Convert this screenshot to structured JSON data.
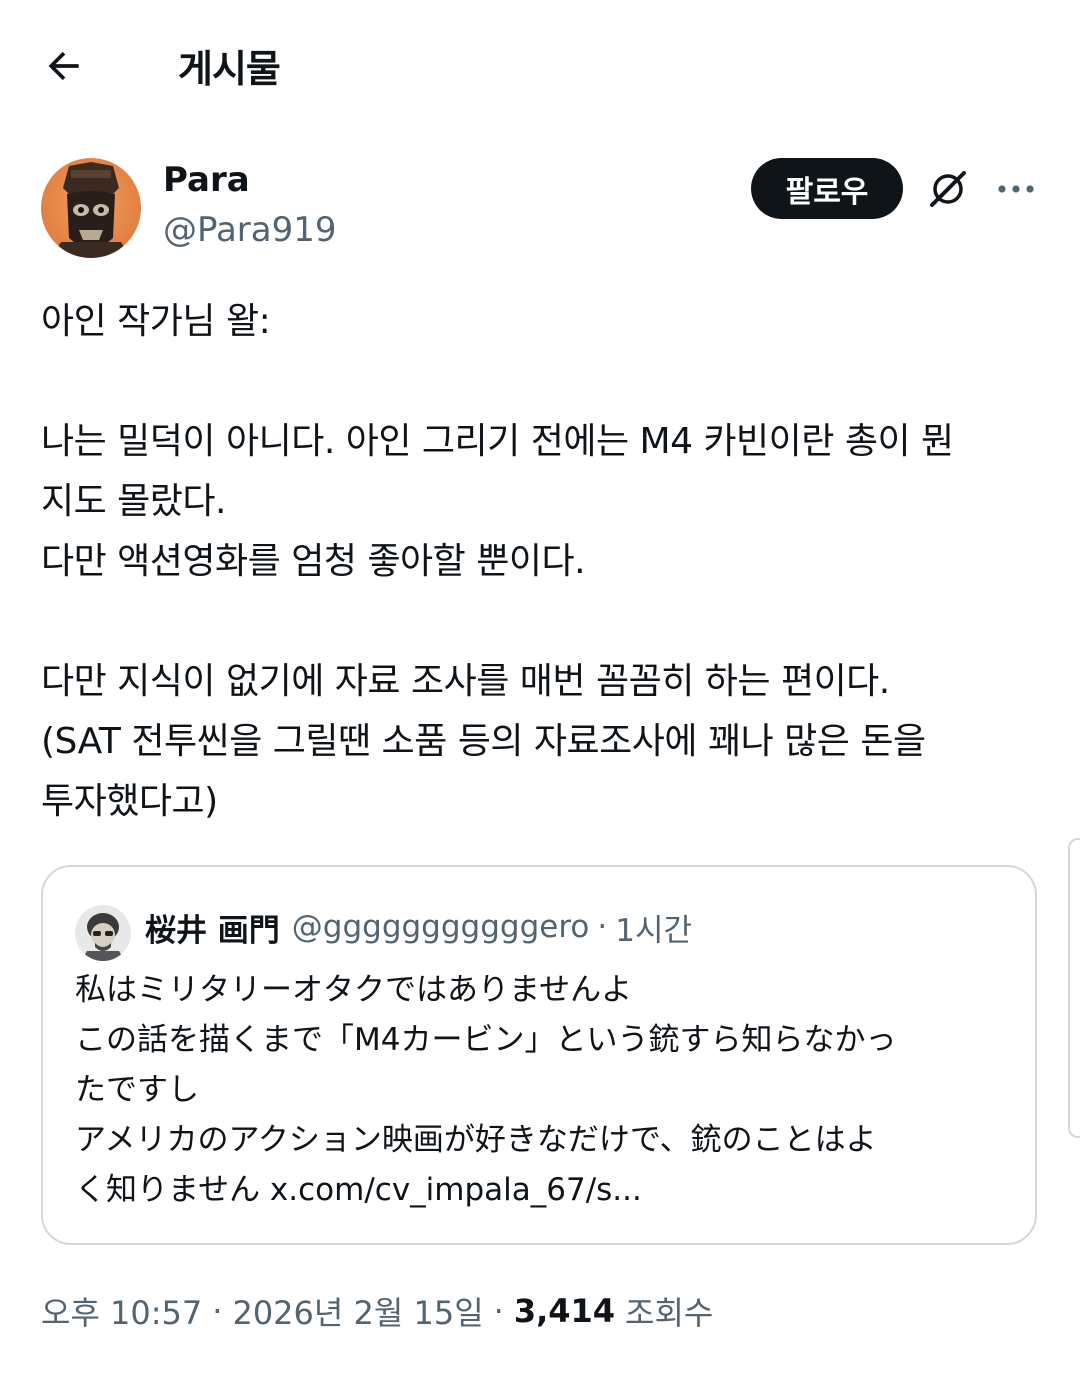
{
  "header": {
    "title": "게시물"
  },
  "author": {
    "display_name": "Para",
    "handle": "@Para919"
  },
  "actions": {
    "follow_label": "팔로우"
  },
  "post": {
    "lines": [
      "아인 작가님 왈:",
      "",
      "나는 밀덕이 아니다. 아인 그리기 전에는 M4 카빈이란 총이 뭔",
      "지도 몰랐다.",
      "다만 액션영화를 엄청 좋아할 뿐이다.",
      "",
      "다만 지식이 없기에 자료 조사를 매번 꼼꼼히 하는 편이다.",
      "(SAT 전투씬을 그릴땐 소품 등의 자료조사에 꽤나 많은 돈을",
      "투자했다고)"
    ]
  },
  "quote": {
    "display_name": "桜井 画門",
    "handle": "@gggggggggggero",
    "separator": "·",
    "time": "1시간",
    "lines": [
      "私はミリタリーオタクではありませんよ",
      "この話を描くまで「M4カービン」という銃すら知らなかっ",
      "たですし",
      "アメリカのアクション映画が好きなだけで、銃のことはよ",
      "く知りません x.com/cv_impala_67/s..."
    ]
  },
  "meta": {
    "time": "오후 10:57",
    "separator": "·",
    "date": "2026년 2월 15일",
    "views_count": "3,414",
    "views_label": "조회수"
  },
  "icons": {
    "back": "arrow-left-icon",
    "grok": "grok-icon",
    "more": "more-horizontal-icon"
  },
  "colors": {
    "text": "#0f1419",
    "secondary": "#536471",
    "border": "#cfd9de",
    "follow_bg": "#0f1419"
  }
}
